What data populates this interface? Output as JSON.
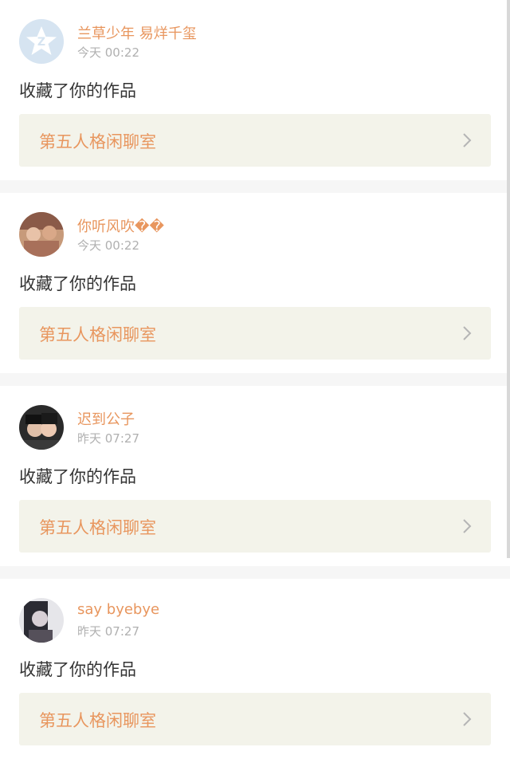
{
  "colors": {
    "accent": "#e8965e",
    "card_bg": "#f3f3ea",
    "separator": "#f6f6f6"
  },
  "items": [
    {
      "username": "兰草少年 易烊千玺",
      "time": "今天 00:22",
      "action": "收藏了你的作品",
      "work_title": "第五人格闲聊室",
      "avatar": "default-star-avatar"
    },
    {
      "username": "你听风吹��",
      "time": "今天 00:22",
      "action": "收藏了你的作品",
      "work_title": "第五人格闲聊室",
      "avatar": "photo-avatar"
    },
    {
      "username": "迟到公子",
      "time": "昨天 07:27",
      "action": "收藏了你的作品",
      "work_title": "第五人格闲聊室",
      "avatar": "photo-avatar"
    },
    {
      "username": "say byebye",
      "time": "昨天 07:27",
      "action": "收藏了你的作品",
      "work_title": "第五人格闲聊室",
      "avatar": "photo-avatar"
    }
  ]
}
